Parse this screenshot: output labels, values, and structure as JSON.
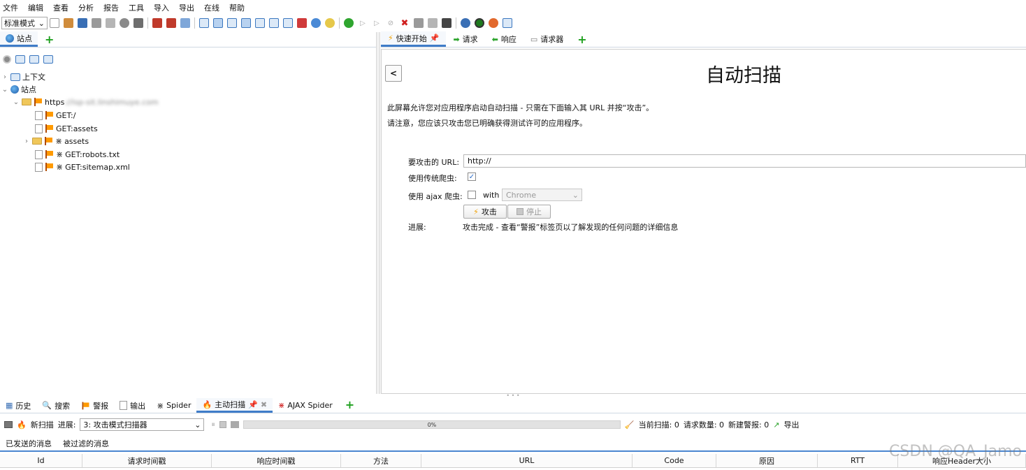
{
  "menu": [
    "文件",
    "编辑",
    "查看",
    "分析",
    "报告",
    "工具",
    "导入",
    "导出",
    "在线",
    "帮助"
  ],
  "toolbar": {
    "mode": "标准模式"
  },
  "left": {
    "tab_label": "站点",
    "tree": {
      "context": "上下文",
      "sites": "站点",
      "host_prefix": "https",
      "host_blurred": "://isp-sit.linshimuye.com",
      "get_root": "GET:/",
      "get_assets": "GET:assets",
      "assets": "assets",
      "robots": "GET:robots.txt",
      "sitemap": "GET:sitemap.xml"
    }
  },
  "right": {
    "tabs": [
      "快速开始",
      "请求",
      "响应",
      "请求器"
    ],
    "back_label": "<",
    "title": "自动扫描",
    "desc1": "此屏幕允许您对应用程序启动自动扫描 - 只需在下面输入其 URL 并按“攻击”。",
    "desc2": "请注意，您应该只攻击您已明确获得测试许可的应用程序。",
    "url_label": "要攻击的 URL:",
    "url_value": "http://",
    "traditional_label": "使用传统爬虫:",
    "ajax_label": "使用 ajax 爬虫:",
    "with_label": "with",
    "browser": "Chrome",
    "attack_btn": "攻击",
    "stop_btn": "停止",
    "progress_label": "进展:",
    "progress_text": "攻击完成 - 查看“警报”标签页以了解发现的任何问题的详细信息"
  },
  "bottom": {
    "tabs": [
      "历史",
      "搜索",
      "警报",
      "输出",
      "Spider",
      "主动扫描",
      "AJAX Spider"
    ],
    "new_scan": "新扫描",
    "progress_label": "进展:",
    "progress_select": "3: 攻击模式扫描器",
    "progress_percent": "0%",
    "progress_value": 0,
    "current_scans": "当前扫描: 0",
    "num_requests": "请求数量: 0",
    "new_alerts": "新建警报: 0",
    "export": "导出",
    "subtabs": [
      "已发送的消息",
      "被过滤的消息"
    ],
    "columns": [
      "Id",
      "请求时间戳",
      "响应时间戳",
      "方法",
      "URL",
      "Code",
      "原因",
      "RTT",
      "响应Header大小"
    ]
  },
  "watermark": "CSDN @QA_Jamo",
  "colors": {
    "accent": "#3f7cc8",
    "add_green": "#1fa01f"
  }
}
